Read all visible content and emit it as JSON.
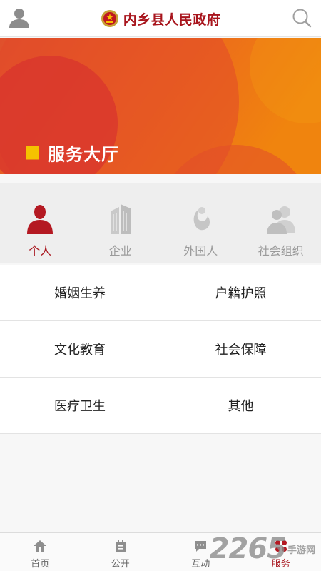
{
  "header": {
    "title": "内乡县人民政府",
    "avatar_icon": "user-icon",
    "emblem_icon": "national-emblem-icon",
    "search_icon": "search-icon"
  },
  "banner": {
    "title": "服务大厅",
    "accent_color": "#f5c200"
  },
  "categories": [
    {
      "label": "个人",
      "icon": "person-icon",
      "active": true
    },
    {
      "label": "企业",
      "icon": "building-icon",
      "active": false
    },
    {
      "label": "外国人",
      "icon": "foreigner-icon",
      "active": false
    },
    {
      "label": "社会组织",
      "icon": "group-icon",
      "active": false
    }
  ],
  "services": [
    {
      "label": "婚姻生养"
    },
    {
      "label": "户籍护照"
    },
    {
      "label": "文化教育"
    },
    {
      "label": "社会保障"
    },
    {
      "label": "医疗卫生"
    },
    {
      "label": "其他"
    }
  ],
  "tabbar": [
    {
      "label": "首页",
      "icon": "home-icon",
      "active": false
    },
    {
      "label": "公开",
      "icon": "calendar-icon",
      "active": false
    },
    {
      "label": "互动",
      "icon": "chat-icon",
      "active": false
    },
    {
      "label": "服务",
      "icon": "service-grid-icon",
      "active": true
    }
  ],
  "watermark": {
    "number": "2265",
    "text": "手游网"
  },
  "colors": {
    "brand": "#a8151d",
    "inactive": "#9b9b9b"
  }
}
